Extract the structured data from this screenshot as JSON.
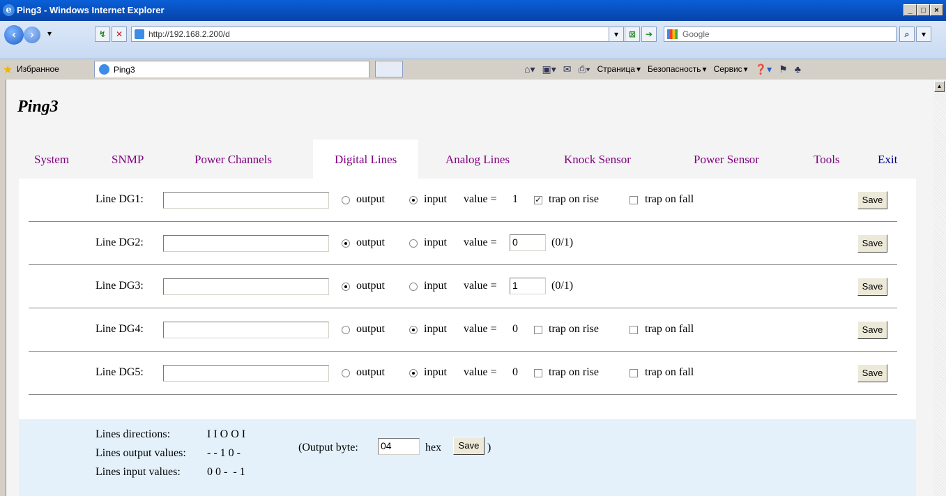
{
  "window": {
    "title": "Ping3 - Windows Internet Explorer"
  },
  "browser": {
    "address": "http://192.168.2.200/d",
    "search_placeholder": "Google",
    "favorites_label": "Избранное",
    "tab_title": "Ping3",
    "toolbar": {
      "page": "Страница",
      "safety": "Безопасность",
      "service": "Сервис"
    }
  },
  "app": {
    "title": "Ping3"
  },
  "nav": {
    "items": [
      "System",
      "SNMP",
      "Power Channels",
      "Digital Lines",
      "Analog Lines",
      "Knock Sensor",
      "Power Sensor",
      "Tools",
      "Exit"
    ],
    "active": "Digital Lines"
  },
  "labels": {
    "output": "output",
    "input": "input",
    "value_eq": "value =",
    "trap_rise": "trap on rise",
    "trap_fall": "trap on fall",
    "range_hint": "(0/1)",
    "save": "Save"
  },
  "lines": [
    {
      "label": "Line DG1:",
      "mode": "input",
      "value": "1",
      "trap_rise": true,
      "trap_fall": false
    },
    {
      "label": "Line DG2:",
      "mode": "output",
      "value": "0"
    },
    {
      "label": "Line DG3:",
      "mode": "output",
      "value": "1"
    },
    {
      "label": "Line DG4:",
      "mode": "input",
      "value": "0",
      "trap_rise": false,
      "trap_fall": false
    },
    {
      "label": "Line DG5:",
      "mode": "input",
      "value": "0",
      "trap_rise": false,
      "trap_fall": false
    }
  ],
  "summary": {
    "directions_label": "Lines directions:",
    "directions_value": "I I O O I",
    "output_label": "Lines output values:",
    "output_value": "- - 1 0 -",
    "input_label": "Lines input values:",
    "input_value": "0 0 -  - 1",
    "output_byte_label": "(Output byte:",
    "output_byte_value": "04",
    "hex_label": "hex",
    "close_paren": ")",
    "save": "Save"
  }
}
